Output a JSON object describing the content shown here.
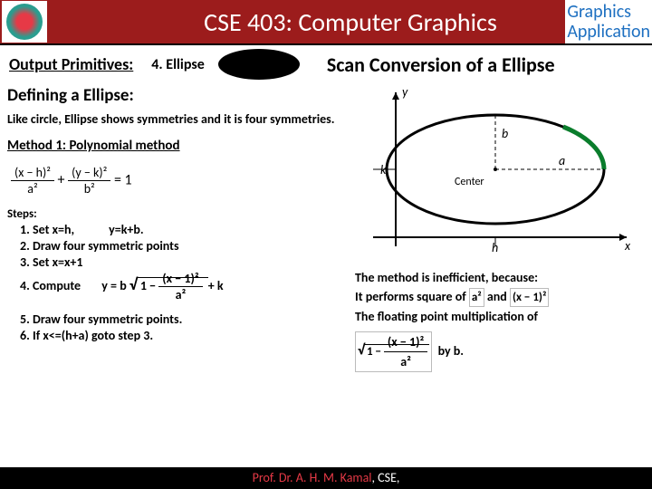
{
  "header": {
    "course_title": "CSE 403: Computer Graphics",
    "app_label_line1": "Graphics",
    "app_label_line2": "Application"
  },
  "subheader": {
    "output_primitives": "Output Primitives:",
    "ellipse_num": "4. Ellipse",
    "scan_title": "Scan Conversion of a Ellipse"
  },
  "left": {
    "defining_title": "Defining a Ellipse:",
    "intro_text": "Like circle, Ellipse shows symmetries and it is four symmetries.",
    "method1_title": "Method 1: Polynomial method",
    "eq1_frac1_top": "(x − h)²",
    "eq1_frac1_bot": "a²",
    "eq1_plus": "+",
    "eq1_frac2_top": "(y − k)²",
    "eq1_frac2_bot": "b²",
    "eq1_eq": "= 1",
    "steps_label": "Steps:",
    "step1": "Set x=h,            y=k+b.",
    "step2": "Draw four symmetric points",
    "step3": "Set x=x+1",
    "step4_label": "Compute",
    "step4_eq_pre": "y = b",
    "step4_eq_frac_top": "(x − 1)²",
    "step4_eq_frac_bot": "a²",
    "step4_eq_post": "+ k",
    "step5": "Draw four symmetric points.",
    "step6": "If x<=(h+a) goto step 3."
  },
  "right": {
    "diagram_labels": {
      "x": "x",
      "y": "y",
      "a": "a",
      "b": "b",
      "k": "k",
      "h": "h",
      "center": "Center"
    },
    "ineff1": "The method is inefficient, because:",
    "ineff2_pre": "It performs square of",
    "ineff2_eq1": "a²",
    "ineff2_mid": "and",
    "ineff2_eq2": "(x − 1)²",
    "ineff3": "The floating point multiplication of",
    "ineff4_eq_frac_top": "(x − 1)²",
    "ineff4_eq_frac_bot": "a²",
    "ineff4_post": "by b."
  },
  "footer": {
    "name": "Prof. Dr. A. H. M. Kamal",
    "rest": ", CSE,"
  }
}
